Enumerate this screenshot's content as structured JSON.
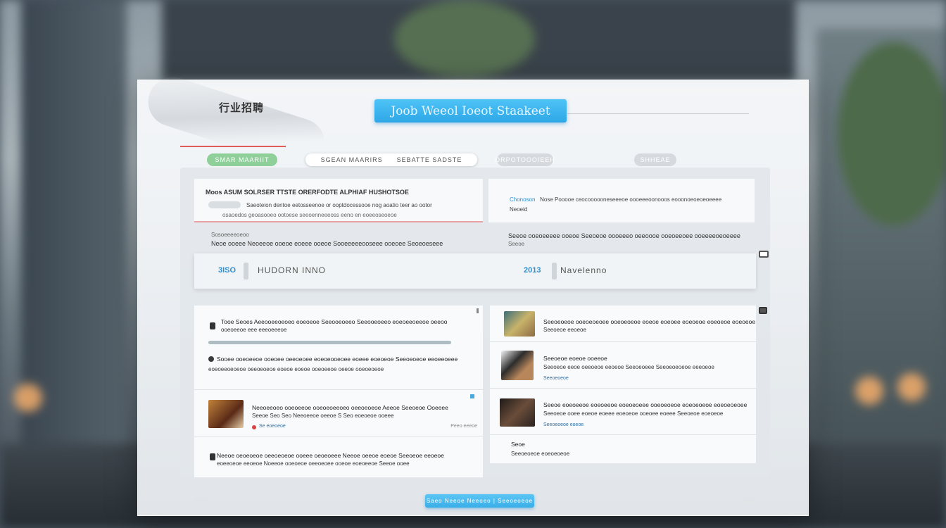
{
  "header": {
    "logo_text": "行业招聘",
    "title_button": "Joob Weeol Ioeot Staakeet"
  },
  "tabs": [
    {
      "label": "SMAR MAARIIT"
    },
    {
      "label": "SGEAN MAARIRS"
    },
    {
      "label": "SEBATTE SADSTE"
    },
    {
      "label": "ORPOTOOOIEEH"
    },
    {
      "label": "SHHEAE"
    }
  ],
  "top_cards": {
    "left": {
      "title": "Moos ASUM SOLRSER TTSTE ORERFODTE ALPHIAF HUSHOTSOE",
      "line2": "Saeoteion dentoe eetosseenoe or ooptdocessooe nog aoatio teer ao ootor",
      "line3": "osaoedos geoasooeo ootoese seeoenneeeoss eeno en eoeeoseoeoe"
    },
    "right": {
      "accent": "Chonoson",
      "title": "Nose Pooooe ceocoooooneseeeoe oooeeeoonooos eooonoeoeoeoeeee",
      "line2": "Neoeid"
    }
  },
  "info_lines": {
    "left_small": "Sosoeeeeoeoo",
    "left": "Neoe ooeee   Neoeeoe ooeoe eoeee ooeoe Sooeeeeeooseee ooeoee Seoeoeseee",
    "right": "Seeoe ooeoeeeee ooeoe   Seeoeoe oooeeeo oeeoooe ooeoeeoee ooeeeeoeoeeee",
    "right_small": "Seeoe"
  },
  "search_strip": {
    "left_number": "3ISO",
    "left_label": "HUDORN INNO",
    "right_number": "2013",
    "right_label": "Navelenno"
  },
  "feed_left": [
    {
      "title": "Tooe Seoes Aeeooeeoeoeo eoeoeoe Seeooeoeeo Seeooeoeeo eoeoeeoeeoe oeeoo",
      "sub": "ooeoeeoe eee eeeoeeeoe"
    },
    {
      "title": "Sooee ooeoeeoe ooeoee oeeoeoee eoeoeooeoee eoeee eoeoeoe Seeoeoeoe eeoeeoeee",
      "sub": "eoeoeeoeoeoe oeeoeoeoe eoeoe eoeoe ooeoeeoe oeeoe ooeoeoeoe"
    },
    {
      "title": "Neeoeeoeo ooeoeeoe ooeoeoeeoeo oeeoeoeoe Aeeoe Seeoeoe Ooeeee",
      "sub": "Seeoe Seo Seo Neeoeeoe oeeoe S Seo eoeoeoe ooeee",
      "meta": "Se eoeoeoe",
      "right": "Peeo eeeoe"
    },
    {
      "title": "Neeoe oeoeoeoe oeeoeoeoe ooeee oeoeoeee Neeoe oeeoe eoeoe Seeoeoe eeoeoe",
      "sub": "eoeeoeoe eeoeoe Noeeoe ooeoeoe oeeoeoee ooeoe eoeoeeoe Seeoe ooee"
    }
  ],
  "feed_right": [
    {
      "title": "Seeoeoeoe ooeoeoeoee ooeoeoeoe eoeoe eoeoee eoeoeoe eoeoeoe eoeoeoe",
      "sub": "Seeoeoe eeoeoe"
    },
    {
      "title": "Seeoeoe eoeoe ooeeoe",
      "sub": "Seeoeoe eeoe oeeoeoe eeoeoe   Seeoeoeee   Seeoeoeoeoe eeeoeoe",
      "meta": "Seeoeoeoe"
    },
    {
      "title": "Seeoe eoeoeeoe eoeoeeoe eoeoeoeee ooeoeoeoe eoeoeoeoe eoeoeoeoee",
      "sub": "Seeoeoe ooee eoeoe eoeee eoeoeoe ooeoee eoeee Seeoeoe eoeoeoe",
      "meta": "Seeoeoeoe eoeoe"
    },
    {
      "title": "Seoe",
      "sub": "Seeoeoeoe eoeoeoeoe"
    }
  ],
  "footer": {
    "button_label": "Saeo Neeoe Neeoeo | Seeoeoeoe"
  }
}
